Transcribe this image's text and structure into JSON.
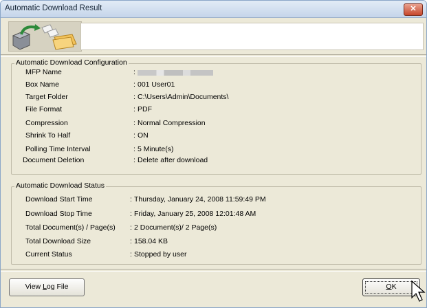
{
  "window": {
    "title": "Automatic Download Result",
    "close_label": "✕"
  },
  "config_group": {
    "legend": "Automatic Download Configuration",
    "rows": [
      {
        "label": "MFP Name",
        "value": ""
      },
      {
        "label": "Box Name",
        "value": "001 User01"
      },
      {
        "label": "Target Folder",
        "value": "C:\\Users\\Admin\\Documents\\"
      },
      {
        "label": "File Format",
        "value": "PDF"
      },
      {
        "label": "Compression",
        "value": "Normal Compression"
      },
      {
        "label": "Shrink To Half",
        "value": "ON"
      },
      {
        "label": "Polling Time Interval",
        "value": "5 Minute(s)"
      },
      {
        "label": "Document Deletion",
        "value": "Delete after download"
      }
    ]
  },
  "status_group": {
    "legend": "Automatic Download Status",
    "rows": [
      {
        "label": "Download Start Time",
        "value": "Thursday, January 24, 2008 11:59:49 PM"
      },
      {
        "label": "Download Stop Time",
        "value": "Friday, January 25, 2008 12:01:48 AM"
      },
      {
        "label": "Total Document(s) / Page(s)",
        "value": "2 Document(s)/ 2 Page(s)"
      },
      {
        "label": "Total Download Size",
        "value": "158.04 KB"
      },
      {
        "label": "Current Status",
        "value": "Stopped by user"
      }
    ]
  },
  "buttons": {
    "view_log_prefix": "View ",
    "view_log_mnemonic": "L",
    "view_log_suffix": "og File",
    "ok_mnemonic": "O",
    "ok_suffix": "K"
  },
  "colon": ":"
}
